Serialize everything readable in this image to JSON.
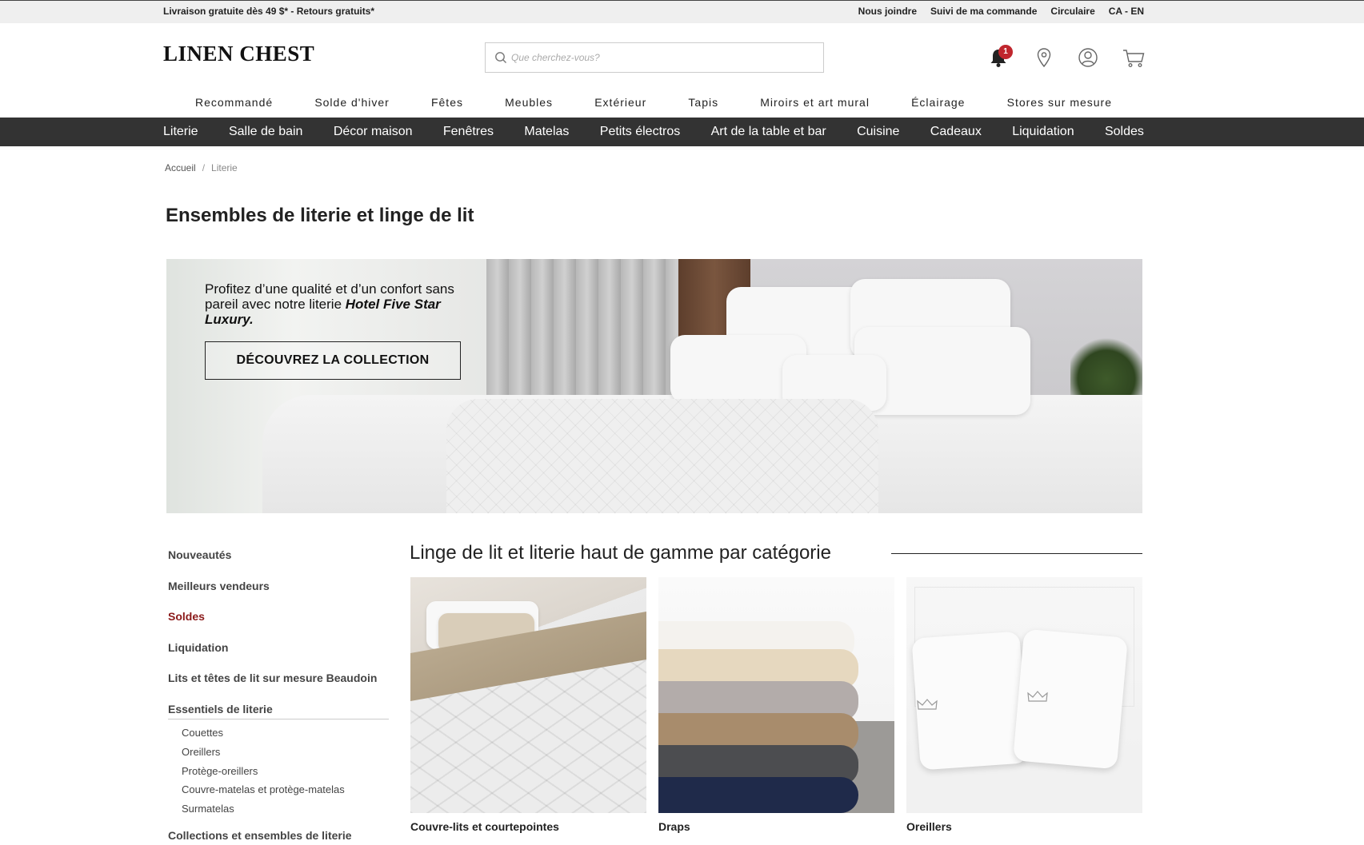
{
  "topbar": {
    "promo": "Livraison gratuite dès 49 $* - Retours gratuits*",
    "links": [
      "Nous joindre",
      "Suivi de ma commande",
      "Circulaire",
      "CA - EN"
    ]
  },
  "header": {
    "logo": "LINEN CHEST",
    "search_placeholder": "Que cherchez-vous?",
    "notification_count": "1",
    "icons": [
      "bell-icon",
      "location-pin-icon",
      "account-icon",
      "cart-icon"
    ]
  },
  "nav_primary": [
    "Recommandé",
    "Solde d'hiver",
    "Fêtes",
    "Meubles",
    "Extérieur",
    "Tapis",
    "Miroirs et art mural",
    "Éclairage",
    "Stores sur mesure"
  ],
  "nav_secondary": [
    "Literie",
    "Salle de bain",
    "Décor maison",
    "Fenêtres",
    "Matelas",
    "Petits électros",
    "Art de la table et bar",
    "Cuisine",
    "Cadeaux",
    "Liquidation",
    "Soldes"
  ],
  "breadcrumb": {
    "home": "Accueil",
    "separator": "/",
    "current": "Literie"
  },
  "page_title": "Ensembles de literie et linge de lit",
  "hero": {
    "text_plain": "Profitez d’une qualité et d’un confort sans pareil avec notre literie ",
    "text_emphasis": "Hotel Five Star Luxury.",
    "cta": "DÉCOUVREZ LA COLLECTION"
  },
  "sidebar": {
    "items": [
      "Nouveautés",
      "Meilleurs vendeurs",
      "Soldes",
      "Liquidation",
      "Lits et têtes de lit sur mesure Beaudoin"
    ],
    "section_heading": "Essentiels de literie",
    "subitems": [
      "Couettes",
      "Oreillers",
      "Protège-oreillers",
      "Couvre-matelas et protège-matelas",
      "Surmatelas"
    ],
    "next_heading": "Collections et ensembles de literie",
    "accent_color": "#8b1a1a"
  },
  "category_section": {
    "title": "Linge de lit et literie haut de gamme par catégorie",
    "cards": [
      "Couvre-lits et courtepointes",
      "Draps",
      "Oreillers"
    ]
  },
  "colors": {
    "nav_bar": "#333333",
    "badge": "#c0262d",
    "topbar": "#efefef"
  }
}
